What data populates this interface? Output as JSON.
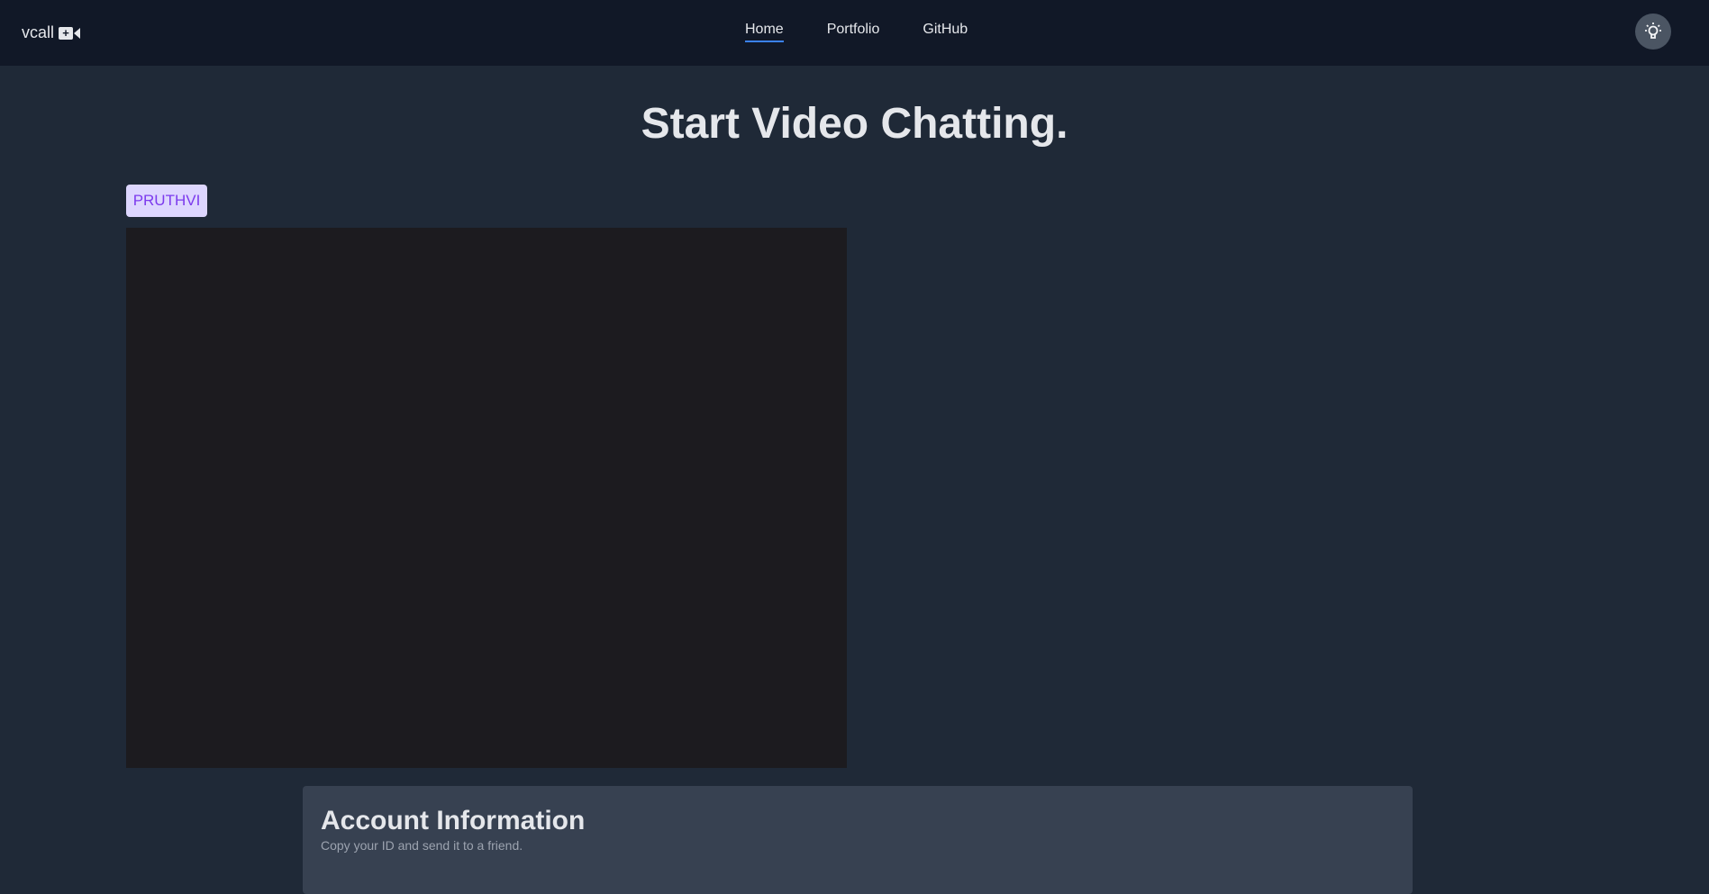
{
  "nav": {
    "logo": "vcall",
    "logo_icon": "video-plus-icon",
    "links": [
      {
        "label": "Home",
        "active": true
      },
      {
        "label": "Portfolio"
      },
      {
        "label": "GitHub"
      }
    ],
    "theme_icon": "lightbulb-icon"
  },
  "main": {
    "title": "Start Video Chatting.",
    "user_badge": "PRUTHVI"
  },
  "account": {
    "title": "Account Information",
    "subtitle": "Copy your ID and send it to a friend."
  },
  "colors": {
    "accent": "#3b82f6",
    "badge_bg": "#ddd6fe",
    "badge_text": "#7c3aed"
  }
}
